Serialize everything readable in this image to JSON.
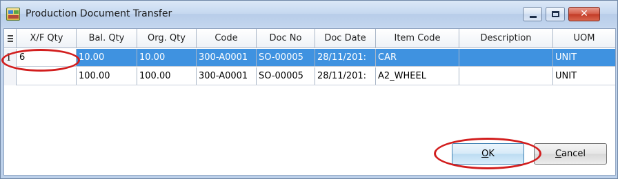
{
  "window": {
    "title": "Production Document Transfer",
    "icon": "app-icon",
    "controls": {
      "minimize": "minimize-icon",
      "maximize": "maximize-icon",
      "close_label": "✕"
    }
  },
  "grid": {
    "columns": [
      "X/F Qty",
      "Bal. Qty",
      "Org. Qty",
      "Code",
      "Doc No",
      "Doc Date",
      "Item Code",
      "Description",
      "UOM"
    ],
    "rows": [
      {
        "xf_qty": "6",
        "bal_qty": "10.00",
        "org_qty": "10.00",
        "code": "300-A0001",
        "doc_no": "SO-00005",
        "doc_date": "28/11/201:",
        "item_code": "CAR",
        "description": "",
        "uom": "UNIT"
      },
      {
        "xf_qty": "",
        "bal_qty": "100.00",
        "org_qty": "100.00",
        "code": "300-A0001",
        "doc_no": "SO-00005",
        "doc_date": "28/11/201:",
        "item_code": "A2_WHEEL",
        "description": "",
        "uom": "UNIT"
      }
    ],
    "selected_row": 0,
    "edit_cursor": "I"
  },
  "buttons": {
    "ok": {
      "mnemonic": "O",
      "rest": "K"
    },
    "cancel": {
      "mnemonic": "C",
      "rest": "ancel"
    }
  },
  "colors": {
    "selection": "#3f92e0",
    "annotation": "#d21e1e",
    "window_bg": "#c9daf0"
  }
}
